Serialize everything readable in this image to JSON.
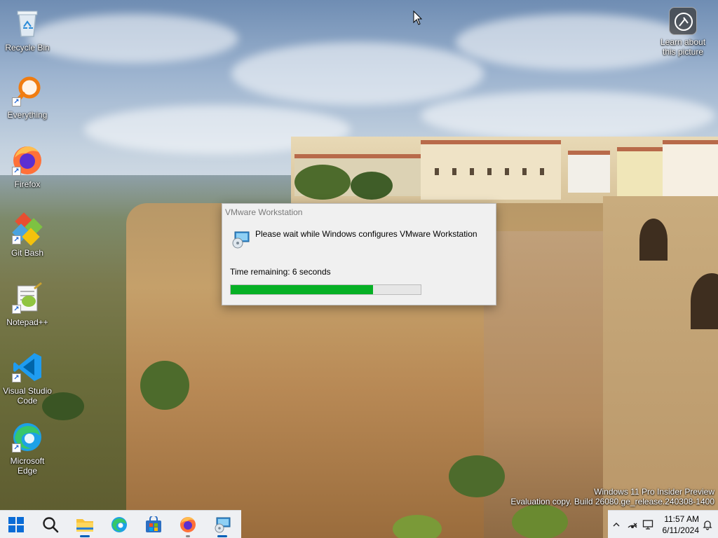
{
  "desktop": {
    "icons": [
      {
        "label": "Recycle Bin",
        "icon": "recycle-bin-icon"
      },
      {
        "label": "Everything",
        "icon": "everything-search-icon"
      },
      {
        "label": "Firefox",
        "icon": "firefox-icon"
      },
      {
        "label": "Git Bash",
        "icon": "git-bash-icon"
      },
      {
        "label": "Notepad++",
        "icon": "notepadpp-icon"
      },
      {
        "label": "Visual Studio Code",
        "icon": "vscode-icon"
      },
      {
        "label": "Microsoft Edge",
        "icon": "edge-icon"
      }
    ],
    "learn_about": {
      "line1": "Learn about",
      "line2": "this picture",
      "icon": "camera-info-icon"
    }
  },
  "dialog": {
    "title": "VMware Workstation",
    "message": "Please wait while Windows configures VMware Workstation",
    "time_remaining": "Time remaining: 6 seconds",
    "progress_fraction": 0.75,
    "progress_color": "#06b025"
  },
  "watermark": {
    "line1": "Windows 11 Pro Insider Preview",
    "line2": "Evaluation copy. Build 26080.ge_release.240308-1400"
  },
  "taskbar": {
    "items": [
      {
        "name": "start",
        "icon": "windows-logo-icon"
      },
      {
        "name": "search",
        "icon": "search-icon"
      },
      {
        "name": "file-explorer",
        "icon": "folder-icon"
      },
      {
        "name": "edge",
        "icon": "edge-icon"
      },
      {
        "name": "store",
        "icon": "store-icon"
      },
      {
        "name": "firefox",
        "icon": "firefox-icon"
      },
      {
        "name": "installer",
        "icon": "installer-icon"
      }
    ]
  },
  "tray": {
    "time": "11:57 AM",
    "date": "6/11/2024",
    "icons": [
      "chevron-up-icon",
      "network-icon",
      "display-icon",
      "notification-bell-icon"
    ]
  },
  "colors": {
    "taskbar_bg": "#eef0f3",
    "accent": "#005fb8"
  }
}
